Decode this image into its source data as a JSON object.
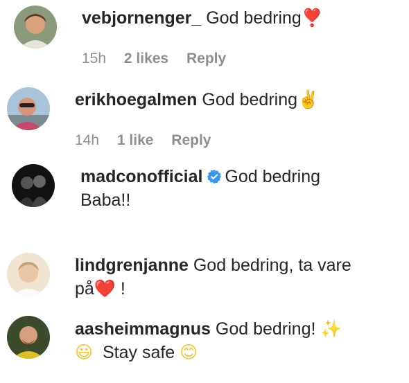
{
  "comments": [
    {
      "username": "vebjornenger_",
      "text": "God bedring",
      "emoji": "❣️",
      "time": "15h",
      "likes": "2 likes",
      "reply": "Reply"
    },
    {
      "username": "erikhoegalmen",
      "text": "God bedring",
      "emoji": "✌️",
      "time": "14h",
      "likes": "1 like",
      "reply": "Reply"
    },
    {
      "username": "madconofficial",
      "verified": true,
      "text_line1": "God bedring",
      "text_line2": "Baba!!"
    },
    {
      "username": "lindgrenjanne",
      "text_line1": "God bedring, ta vare",
      "text_line2_prefix": "på",
      "text_line2_emoji": "❤️",
      "text_line2_suffix": " !"
    },
    {
      "username": "aasheimmagnus",
      "text_line1": "God bedring!",
      "emoji_sparkles": "✨",
      "emoji_grin": "😃",
      "text_line2": "Stay safe",
      "emoji_smile": "😊"
    }
  ],
  "colors": {
    "text": "#262626",
    "meta": "#8e8e8e",
    "verified": "#3897f0",
    "heart": "#ed4956"
  }
}
